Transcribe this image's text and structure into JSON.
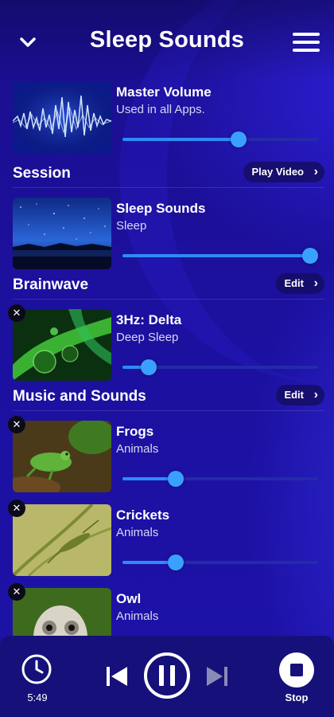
{
  "header": {
    "title": "Sleep Sounds"
  },
  "master": {
    "name": "Master Volume",
    "sub": "Used in all Apps.",
    "level": 0.6
  },
  "sections": {
    "session": {
      "label": "Session",
      "button": "Play Video"
    },
    "brainwave": {
      "label": "Brainwave",
      "button": "Edit"
    },
    "music": {
      "label": "Music and Sounds",
      "button": "Edit"
    }
  },
  "items": [
    {
      "name": "Sleep Sounds",
      "sub": "Sleep",
      "level": 1.0
    },
    {
      "name": "3Hz: Delta",
      "sub": "Deep Sleep",
      "level": 0.1
    },
    {
      "name": "Frogs",
      "sub": "Animals",
      "level": 0.25
    },
    {
      "name": "Crickets",
      "sub": "Animals",
      "level": 0.25
    },
    {
      "name": "Owl",
      "sub": "Animals"
    }
  ],
  "player": {
    "timer": "5:49",
    "stop_label": "Stop"
  },
  "icons": [
    "chevron-down-icon",
    "menu-icon",
    "close-icon",
    "clock-icon",
    "previous-icon",
    "pause-icon",
    "next-icon",
    "stop-icon",
    "chevron-right-icon"
  ],
  "colors": {
    "accent": "#3aa0ff",
    "background": "#1c109e",
    "player_bar": "#16107a"
  }
}
